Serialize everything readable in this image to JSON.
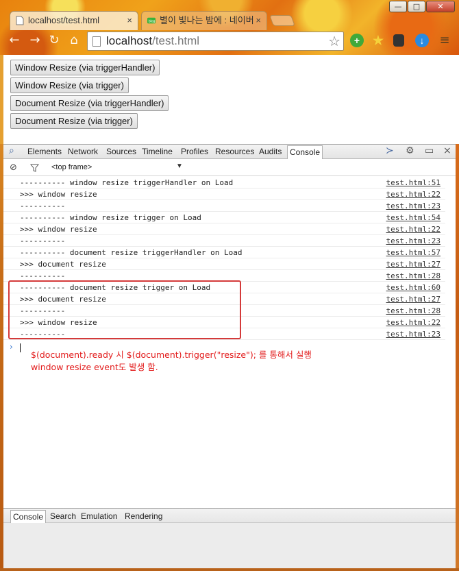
{
  "window": {
    "minimize": "—",
    "maximize": "□",
    "close": "✕"
  },
  "tabs": [
    {
      "title": "localhost/test.html",
      "close": "×"
    },
    {
      "title": "별이 빛나는 밤에 : 네이버",
      "close": "×"
    }
  ],
  "toolbar": {
    "url_host": "localhost",
    "url_path": "/test.html"
  },
  "page": {
    "buttons": [
      "Window Resize (via triggerHandler)",
      "Window Resize (via trigger)",
      "Document Resize (via triggerHandler)",
      "Document Resize (via trigger)"
    ]
  },
  "devtools": {
    "tabs": [
      "Elements",
      "Network",
      "Sources",
      "Timeline",
      "Profiles",
      "Resources",
      "Audits",
      "Console"
    ],
    "selected_tab": "Console",
    "frame_select": "<top frame>",
    "close": "×",
    "logs": [
      {
        "msg": "---------- window resize triggerHandler on Load",
        "src": "test.html:51"
      },
      {
        "msg": ">>> window resize",
        "src": "test.html:22"
      },
      {
        "msg": "----------",
        "src": "test.html:23"
      },
      {
        "msg": "---------- window resize trigger on Load",
        "src": "test.html:54"
      },
      {
        "msg": ">>> window resize",
        "src": "test.html:22"
      },
      {
        "msg": "----------",
        "src": "test.html:23"
      },
      {
        "msg": "---------- document resize triggerHandler on Load",
        "src": "test.html:57"
      },
      {
        "msg": ">>> document resize",
        "src": "test.html:27"
      },
      {
        "msg": "----------",
        "src": "test.html:28"
      },
      {
        "msg": "---------- document resize trigger on Load",
        "src": "test.html:60"
      },
      {
        "msg": ">>> document resize",
        "src": "test.html:27"
      },
      {
        "msg": "----------",
        "src": "test.html:28"
      },
      {
        "msg": ">>> window resize",
        "src": "test.html:22"
      },
      {
        "msg": "----------",
        "src": "test.html:23"
      }
    ],
    "prompt": "›",
    "annotation": {
      "line1": "$(document).ready 시 $(document).trigger(\"resize\"); 를 통해서 실행",
      "line2": "window resize event도 발생 함."
    },
    "drawer_tabs": [
      "Console",
      "Search",
      "Emulation",
      "Rendering"
    ]
  },
  "colors": {
    "annotation": "#e21a1a",
    "highlight_box": "#d43a3a",
    "prompt": "#3a78d0"
  }
}
